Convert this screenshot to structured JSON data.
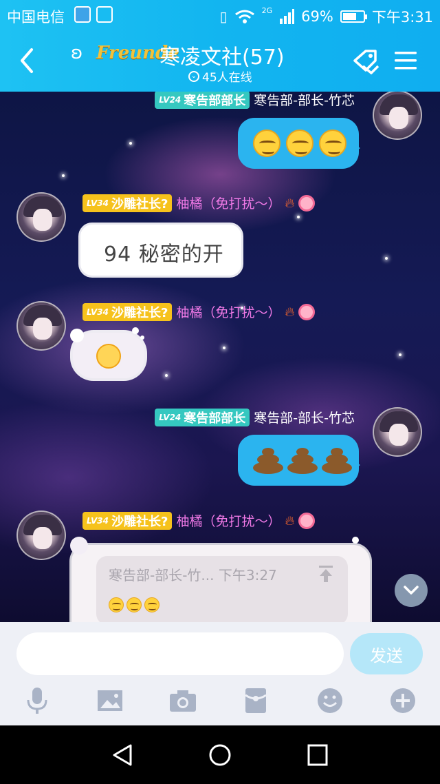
{
  "status_bar": {
    "carrier": "中国电信",
    "network": "2G",
    "battery_percent": "69%",
    "battery_level": 0.69,
    "time": "下午3:31"
  },
  "header": {
    "logo_text": "Freunde",
    "group_title": "寒凌文社(57)",
    "online_text": "45人在线"
  },
  "messages": [
    {
      "sender_level": "LV24",
      "sender_title": "寒告部部长",
      "sender_name": "寒告部-部长-竹芯",
      "direction": "outgoing",
      "content": [
        "smirk-emoji",
        "smirk-emoji",
        "smirk-emoji"
      ]
    },
    {
      "sender_level": "LV34",
      "sender_title": "沙雕社长?",
      "sender_name": "柚橘（免打扰～）",
      "direction": "incoming",
      "text": "94 秘密的开"
    },
    {
      "sender_level": "LV34",
      "sender_title": "沙雕社长?",
      "sender_name": "柚橘（免打扰～）",
      "direction": "incoming",
      "content": [
        "duck-sticker"
      ]
    },
    {
      "sender_level": "LV24",
      "sender_title": "寒告部部长",
      "sender_name": "寒告部-部长-竹芯",
      "direction": "outgoing",
      "content": [
        "poop-emoji",
        "poop-emoji",
        "poop-emoji"
      ]
    },
    {
      "sender_level": "LV34",
      "sender_title": "沙雕社长?",
      "sender_name": "柚橘（免打扰～）",
      "direction": "incoming",
      "reply": {
        "quoted_sender": "寒告部-部长-竹...",
        "quoted_time": "下午3:27",
        "quoted_content": [
          "smirk-emoji",
          "smirk-emoji",
          "smirk-emoji"
        ]
      }
    }
  ],
  "input": {
    "placeholder": "",
    "value": "",
    "send_label": "发送"
  },
  "toolbar_icons": [
    "microphone-icon",
    "image-icon",
    "camera-icon",
    "red-packet-icon",
    "emoji-icon",
    "plus-icon"
  ],
  "colors": {
    "header": "#12b5f0",
    "outgoing_bubble": "#2bb4ef",
    "badge_lv24": "#35c8c0",
    "badge_lv34": "#f6c21c",
    "nick_incoming": "#f27ae8"
  }
}
